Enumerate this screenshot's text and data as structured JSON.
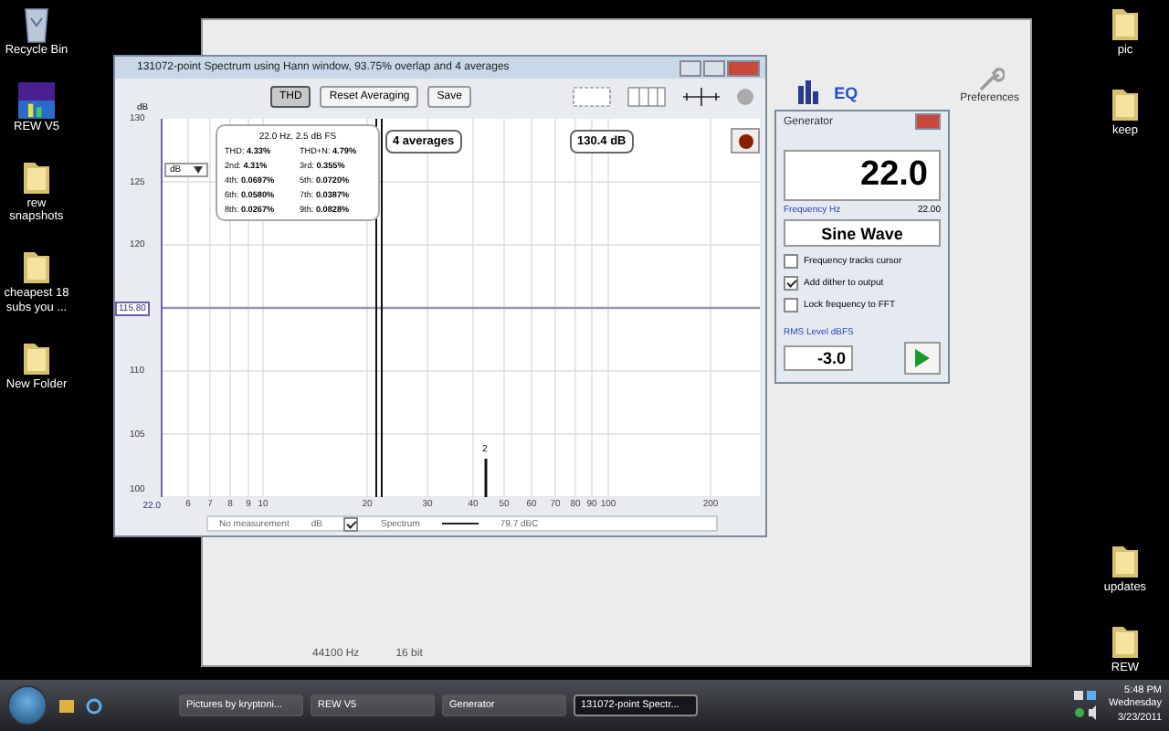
{
  "desktop_icons_left": [
    {
      "label": "Recycle Bin",
      "kind": "bin"
    },
    {
      "label": "REW V5",
      "kind": "app"
    },
    {
      "label": "rew snapshots",
      "kind": "folder"
    },
    {
      "label": "cheapest 18 subs you ...",
      "kind": "folder"
    },
    {
      "label": "New Folder",
      "kind": "folder"
    }
  ],
  "desktop_icons_right_top": [
    {
      "label": "pic",
      "kind": "folder"
    },
    {
      "label": "keep",
      "kind": "folder"
    }
  ],
  "desktop_icons_right_bottom": [
    {
      "label": "updates",
      "kind": "folder"
    },
    {
      "label": "REW",
      "kind": "folder"
    }
  ],
  "main_window": {
    "eq_label": "EQ",
    "preferences_label": "Preferences",
    "status": [
      "44100 Hz",
      "16 bit"
    ]
  },
  "spectrum_window": {
    "title": "131072-point Spectrum using Hann window, 93.75% overlap and 4 averages",
    "buttons": [
      {
        "label": "THD",
        "selected": true
      },
      {
        "label": "Reset Averaging",
        "selected": false
      },
      {
        "label": "Save",
        "selected": false
      }
    ],
    "y_unit": "dB",
    "unit_select": "dB",
    "y_labels": [
      "130",
      "125",
      "120",
      "110",
      "105",
      "100"
    ],
    "cursor_level": "115.80",
    "cursor_freq": "22.0",
    "x_labels": [
      "6",
      "7",
      "8",
      "9",
      "10",
      "20",
      "30",
      "40",
      "50",
      "60",
      "70",
      "80",
      "90",
      "100",
      "200"
    ],
    "thd": {
      "header": "22.0 Hz, 2.5 dB FS",
      "items": [
        {
          "label": "THD:",
          "value": "4.33%"
        },
        {
          "label": "THD+N:",
          "value": "4.79%"
        },
        {
          "label": "2nd:",
          "value": "4.31%"
        },
        {
          "label": "3rd:",
          "value": "0.355%"
        },
        {
          "label": "4th:",
          "value": "0.0697%"
        },
        {
          "label": "5th:",
          "value": "0.0720%"
        },
        {
          "label": "6th:",
          "value": "0.0580%"
        },
        {
          "label": "7th:",
          "value": "0.0387%"
        },
        {
          "label": "8th:",
          "value": "0.0267%"
        },
        {
          "label": "9th:",
          "value": "0.0828%"
        }
      ]
    },
    "averages": "4 averages",
    "peak": "130.4 dB",
    "harmonic_marker": "2",
    "legend": {
      "measurement": "No measurement",
      "unit": "dB",
      "trace": "Spectrum",
      "trace_checked": true,
      "reading": "79.7 dBC"
    }
  },
  "generator": {
    "title": "Generator",
    "display": "22.0",
    "freq_label": "Frequency Hz",
    "freq_value": "22.00",
    "waveform": "Sine Wave",
    "options": [
      {
        "label": "Frequency tracks cursor",
        "checked": false
      },
      {
        "label": "Add dither to output",
        "checked": true
      },
      {
        "label": "Lock frequency to FFT",
        "checked": false
      }
    ],
    "level_label": "RMS Level dBFS",
    "level_value": "-3.0"
  },
  "taskbar": {
    "tasks": [
      {
        "label": "Pictures by kryptoni...",
        "selected": false
      },
      {
        "label": "REW V5",
        "selected": false
      },
      {
        "label": "Generator",
        "selected": false
      },
      {
        "label": "131072-point Spectr...",
        "selected": true
      }
    ],
    "time": "5:48 PM",
    "day": "Wednesday",
    "date": "3/23/2011"
  }
}
